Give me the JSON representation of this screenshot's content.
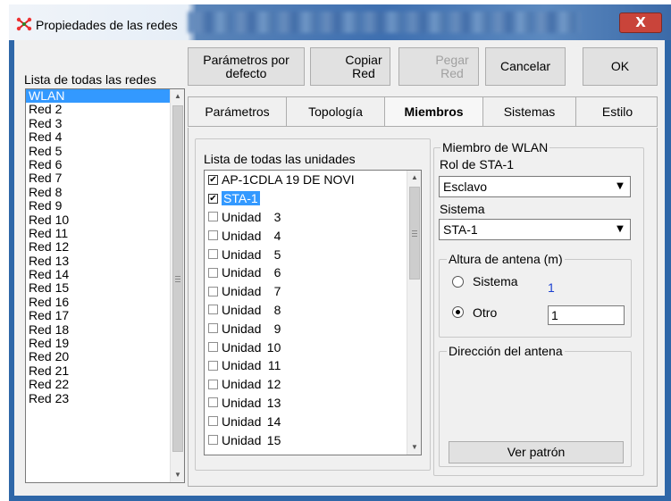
{
  "window": {
    "title": "Propiedades de las redes",
    "close_label": "X"
  },
  "left_panel": {
    "label": "Lista de todas las redes",
    "items": [
      "WLAN",
      "Red 2",
      "Red 3",
      "Red 4",
      "Red 5",
      "Red 6",
      "Red 7",
      "Red 8",
      "Red 9",
      "Red 10",
      "Red 11",
      "Red 12",
      "Red 13",
      "Red 14",
      "Red 15",
      "Red 16",
      "Red 17",
      "Red 18",
      "Red 19",
      "Red 20",
      "Red 21",
      "Red 22",
      "Red 23"
    ],
    "selected_index": 0
  },
  "toolbar": {
    "defaults_line1": "Parámetros por",
    "defaults_line2": "defecto",
    "copy_line1": "Copiar",
    "copy_line2": "Red",
    "paste_line1": "Pegar",
    "paste_line2": "Red",
    "cancel_label": "Cancelar",
    "ok_label": "OK"
  },
  "tabs": [
    {
      "label": "Parámetros",
      "active": false
    },
    {
      "label": "Topología",
      "active": false
    },
    {
      "label": "Miembros",
      "active": true
    },
    {
      "label": "Sistemas",
      "active": false
    },
    {
      "label": "Estilo",
      "active": false
    }
  ],
  "members": {
    "list_label": "Lista de todas las unidades",
    "units": [
      {
        "label": "AP-1CDLA 19 DE NOVI",
        "number": "",
        "checked": true,
        "selected": false
      },
      {
        "label": "STA-1",
        "number": "",
        "checked": true,
        "selected": true
      },
      {
        "label": "Unidad",
        "number": "3",
        "checked": false,
        "selected": false
      },
      {
        "label": "Unidad",
        "number": "4",
        "checked": false,
        "selected": false
      },
      {
        "label": "Unidad",
        "number": "5",
        "checked": false,
        "selected": false
      },
      {
        "label": "Unidad",
        "number": "6",
        "checked": false,
        "selected": false
      },
      {
        "label": "Unidad",
        "number": "7",
        "checked": false,
        "selected": false
      },
      {
        "label": "Unidad",
        "number": "8",
        "checked": false,
        "selected": false
      },
      {
        "label": "Unidad",
        "number": "9",
        "checked": false,
        "selected": false
      },
      {
        "label": "Unidad",
        "number": "10",
        "checked": false,
        "selected": false
      },
      {
        "label": "Unidad",
        "number": "11",
        "checked": false,
        "selected": false
      },
      {
        "label": "Unidad",
        "number": "12",
        "checked": false,
        "selected": false
      },
      {
        "label": "Unidad",
        "number": "13",
        "checked": false,
        "selected": false
      },
      {
        "label": "Unidad",
        "number": "14",
        "checked": false,
        "selected": false
      },
      {
        "label": "Unidad",
        "number": "15",
        "checked": false,
        "selected": false
      }
    ]
  },
  "member_group": {
    "caption": "Miembro de WLAN",
    "role_label": "Rol de STA-1",
    "role_value": "Esclavo",
    "system_label": "Sistema",
    "system_value": "STA-1"
  },
  "antenna_height": {
    "caption": "Altura de antena (m)",
    "system_option": "Sistema",
    "system_value": "1",
    "other_option": "Otro",
    "other_value": "1",
    "selected": "Otro"
  },
  "antenna_direction": {
    "caption": "Dirección del antena",
    "pattern_button": "Ver patrón"
  },
  "colors": {
    "selection": "#3399ff",
    "system_value_text": "#1a3fd0"
  }
}
